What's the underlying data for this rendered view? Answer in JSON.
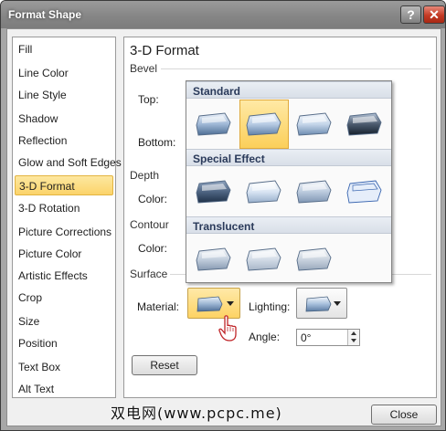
{
  "window": {
    "title": "Format Shape",
    "help_glyph": "?",
    "close_glyph": "✕"
  },
  "categories": [
    {
      "label": "Fill"
    },
    {
      "label": "Line Color"
    },
    {
      "label": "Line Style"
    },
    {
      "label": "Shadow"
    },
    {
      "label": "Reflection"
    },
    {
      "label": "Glow and Soft Edges"
    },
    {
      "label": "3-D Format",
      "selected": true
    },
    {
      "label": "3-D Rotation"
    },
    {
      "label": "Picture Corrections"
    },
    {
      "label": "Picture Color"
    },
    {
      "label": "Artistic Effects"
    },
    {
      "label": "Crop"
    },
    {
      "label": "Size"
    },
    {
      "label": "Position"
    },
    {
      "label": "Text Box"
    },
    {
      "label": "Alt Text"
    }
  ],
  "panel": {
    "title": "3-D Format",
    "bevel": {
      "heading": "Bevel",
      "top_label": "Top:",
      "bottom_label": "Bottom:"
    },
    "depth": {
      "heading": "Depth",
      "color_label": "Color:"
    },
    "contour": {
      "heading": "Contour",
      "color_label": "Color:"
    },
    "surface": {
      "heading": "Surface",
      "material_label": "Material:",
      "lighting_label": "Lighting:",
      "angle_label": "Angle:",
      "angle_value": "0°"
    },
    "reset_label": "Reset"
  },
  "gallery": {
    "sections": [
      {
        "heading": "Standard",
        "item_count": 4,
        "selected_index": 1
      },
      {
        "heading": "Special Effect",
        "item_count": 4
      },
      {
        "heading": "Translucent",
        "item_count": 3
      }
    ]
  },
  "footer": {
    "close_label": "Close"
  },
  "watermark": "双电网(www.pcpc.me)",
  "colors": {
    "selection": "#fbd36a",
    "titlebar": "#868686",
    "close_button": "#c43a24"
  }
}
